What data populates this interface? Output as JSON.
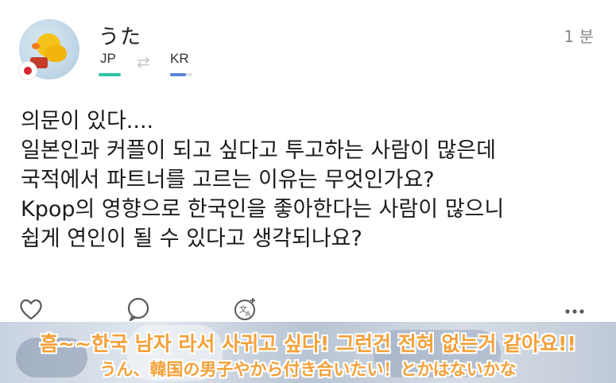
{
  "post": {
    "username": "うた",
    "time": "1 분",
    "languages": {
      "from": "JP",
      "to": "KR",
      "swap_glyph": "⇄"
    },
    "avatar": "yellow-chick-avatar",
    "flag": "japan-flag",
    "body_lines": [
      "의문이 있다....",
      "일본인과 커플이 되고 싶다고 투고하는 사람이 많은데",
      "국적에서 파트너를 고르는 이유는 무엇인가요?",
      "Kpop의 영향으로 한국인을 좋아한다는 사람이 많으니",
      "쉽게 연인이 될 수 있다고 생각되나요?"
    ],
    "actions": [
      "heart-icon",
      "comment-icon",
      "translate-icon",
      "more-icon"
    ]
  },
  "caption": {
    "korean": "흠~~한국 남자 라서 사귀고 싶다! 그런건 전혀 없는거 같아요!!",
    "japanese": "うん、韓国の男子やから付き合いたい！とかはないかな",
    "text_color": "#f3a13a"
  },
  "colors": {
    "jp_accent": "#2ec4a6",
    "kr_accent": "#5a86d8",
    "flag_red": "#d7262e"
  }
}
